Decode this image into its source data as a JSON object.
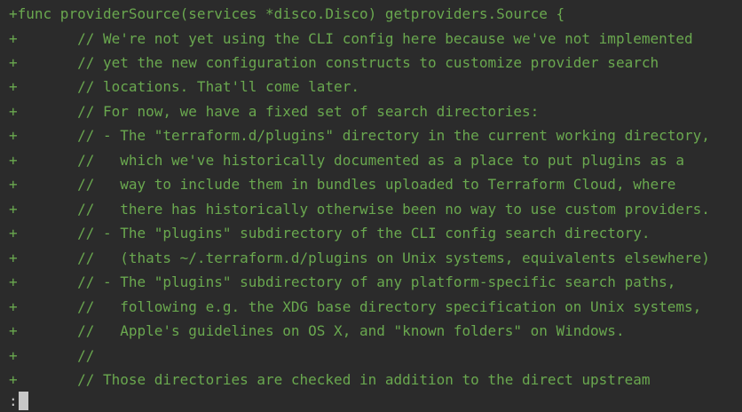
{
  "diff_lines": [
    {
      "prefix": "+",
      "text": "func providerSource(services *disco.Disco) getproviders.Source {"
    },
    {
      "prefix": "+",
      "text": "       // We're not yet using the CLI config here because we've not implemented"
    },
    {
      "prefix": "+",
      "text": "       // yet the new configuration constructs to customize provider search"
    },
    {
      "prefix": "+",
      "text": "       // locations. That'll come later."
    },
    {
      "prefix": "+",
      "text": "       // For now, we have a fixed set of search directories:"
    },
    {
      "prefix": "+",
      "text": "       // - The \"terraform.d/plugins\" directory in the current working directory,"
    },
    {
      "prefix": "+",
      "text": "       //   which we've historically documented as a place to put plugins as a"
    },
    {
      "prefix": "+",
      "text": "       //   way to include them in bundles uploaded to Terraform Cloud, where"
    },
    {
      "prefix": "+",
      "text": "       //   there has historically otherwise been no way to use custom providers."
    },
    {
      "prefix": "+",
      "text": "       // - The \"plugins\" subdirectory of the CLI config search directory."
    },
    {
      "prefix": "+",
      "text": "       //   (thats ~/.terraform.d/plugins on Unix systems, equivalents elsewhere)"
    },
    {
      "prefix": "+",
      "text": "       // - The \"plugins\" subdirectory of any platform-specific search paths,"
    },
    {
      "prefix": "+",
      "text": "       //   following e.g. the XDG base directory specification on Unix systems,"
    },
    {
      "prefix": "+",
      "text": "       //   Apple's guidelines on OS X, and \"known folders\" on Windows."
    },
    {
      "prefix": "+",
      "text": "       //"
    },
    {
      "prefix": "+",
      "text": "       // Those directories are checked in addition to the direct upstream"
    }
  ],
  "prompt": ":",
  "colors": {
    "background": "#2b2b2b",
    "diff_added": "#6aa84f",
    "cursor": "#c8c8c8"
  }
}
